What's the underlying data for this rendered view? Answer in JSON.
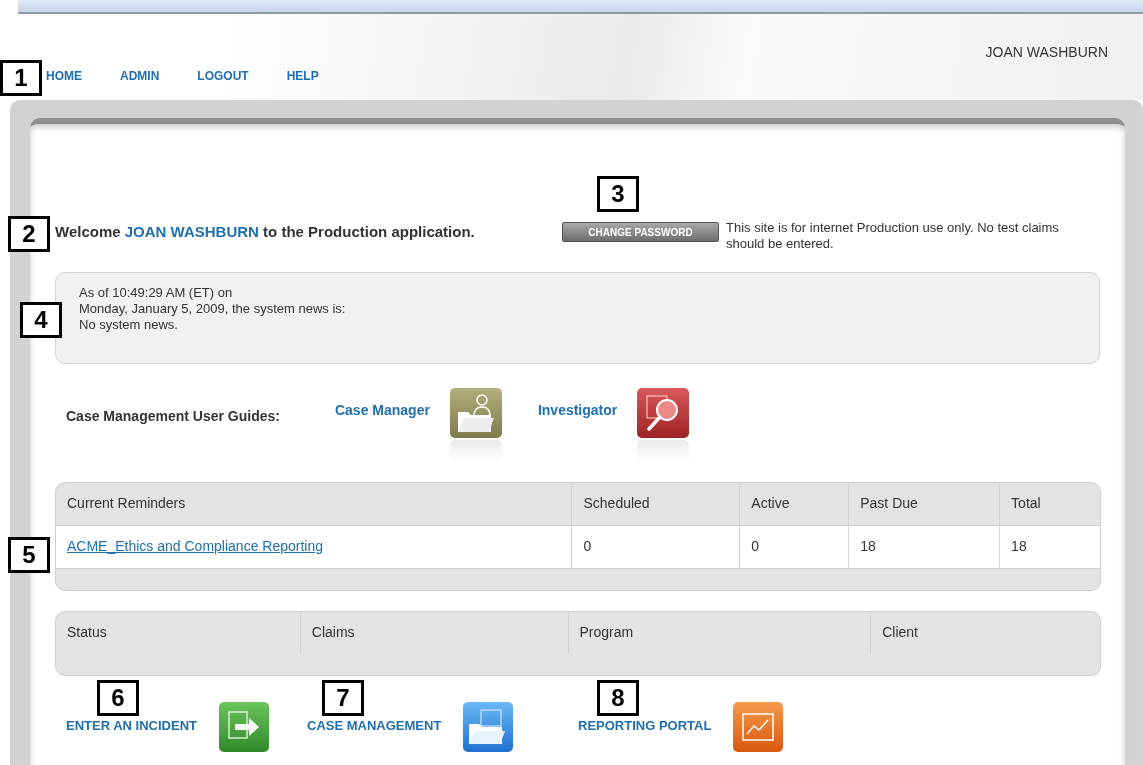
{
  "nav": {
    "links": [
      "HOME",
      "ADMIN",
      "LOGOUT",
      "HELP"
    ],
    "user": "JOAN WASHBURN"
  },
  "welcome": {
    "prefix": "Welcome",
    "name": "JOAN WASHBURN",
    "suffix": "to the Production application.",
    "button": "CHANGE PASSWORD",
    "notice": "This site is for internet Production use only. No test claims should be entered."
  },
  "news": [
    "As of 10:49:29 AM (ET) on",
    "Monday, January 5, 2009, the system news is:",
    "No system news."
  ],
  "guides": {
    "label": "Case Management User Guides:",
    "items": [
      {
        "label": "Case Manager",
        "kind": "person-folder"
      },
      {
        "label": "Investigator",
        "kind": "magnifier"
      }
    ]
  },
  "reminders": {
    "columns": [
      "Current Reminders",
      "Scheduled",
      "Active",
      "Past Due",
      "Total"
    ],
    "rows": [
      [
        "ACME_Ethics and Compliance Reporting",
        "0",
        "0",
        "18",
        "18"
      ]
    ]
  },
  "status_table": {
    "columns": [
      "Status",
      "Claims",
      "Program",
      "Client"
    ]
  },
  "actions": [
    {
      "label": "ENTER AN INCIDENT",
      "kind": "enter"
    },
    {
      "label": "CASE MANAGEMENT",
      "kind": "folder"
    },
    {
      "label": "REPORTING PORTAL",
      "kind": "chart"
    }
  ],
  "callouts": [
    "1",
    "2",
    "3",
    "4",
    "5",
    "6",
    "7",
    "8"
  ]
}
